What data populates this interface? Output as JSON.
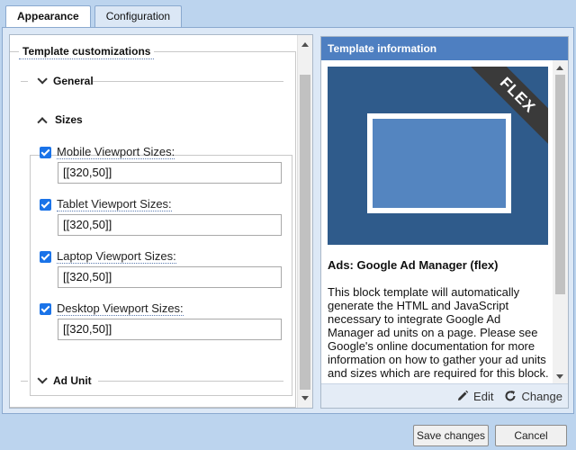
{
  "tabs": [
    {
      "label": "Appearance",
      "active": true
    },
    {
      "label": "Configuration",
      "active": false
    }
  ],
  "left": {
    "title": "Template customizations",
    "sections": {
      "general": "General",
      "sizes": "Sizes",
      "ad_unit": "Ad Unit"
    },
    "fields": [
      {
        "label": "Mobile Viewport Sizes:",
        "value": "[[320,50]]",
        "checked": true
      },
      {
        "label": "Tablet Viewport Sizes:",
        "value": "[[320,50]]",
        "checked": true
      },
      {
        "label": "Laptop Viewport Sizes:",
        "value": "[[320,50]]",
        "checked": true
      },
      {
        "label": "Desktop Viewport Sizes:",
        "value": "[[320,50]]",
        "checked": true
      }
    ]
  },
  "right": {
    "header": "Template information",
    "badge": "FLEX",
    "template_title": "Ads: Google Ad Manager (flex)",
    "description": "This block template will automatically generate the HTML and JavaScript necessary to integrate Google Ad Manager ad units on a page. Please see Google's online documentation for more information on how to gather your ad units and sizes which are required for this block.",
    "edit_label": "Edit",
    "change_label": "Change"
  },
  "footer": {
    "save_label": "Save changes",
    "cancel_label": "Cancel"
  },
  "colors": {
    "accent": "#4e7fc1",
    "background": "#bcd4ee",
    "checkbox": "#1a73e8"
  }
}
